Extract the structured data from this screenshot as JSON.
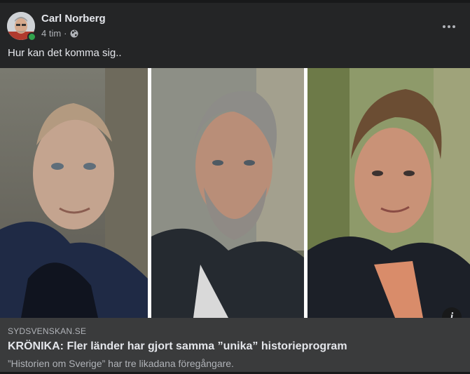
{
  "post": {
    "author": "Carl Norberg",
    "time": "4 tim",
    "separator": "·",
    "privacy_icon": "globe-icon",
    "more_icon": "more-horizontal-icon",
    "text": "Hur kan det komma sig.."
  },
  "link": {
    "domain": "SYDSVENSKAN.SE",
    "title": "KRÖNIKA: Fler länder har gjort samma ”unika” historieprogram",
    "description": "”Historien om Sverige” har tre likadana föregångare.",
    "info_icon": "info-icon",
    "info_glyph": "i"
  },
  "colors": {
    "background": "#18191a",
    "card": "#242526",
    "link_box": "#3a3b3c",
    "primary_text": "#e4e6eb",
    "secondary_text": "#b0b3b8",
    "online": "#31a24c"
  }
}
